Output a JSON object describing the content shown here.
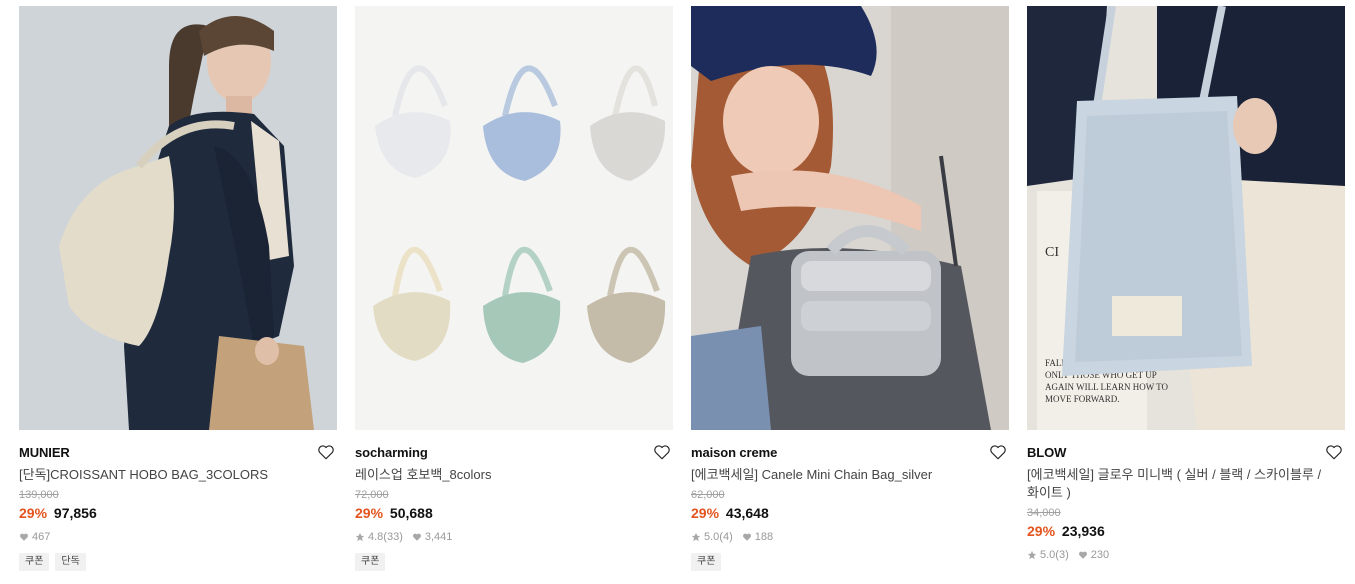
{
  "products": [
    {
      "brand": "MUNIER",
      "name": "[단독]CROISSANT HOBO BAG_3COLORS",
      "original_price": "139,000",
      "discount": "29%",
      "price": "97,856",
      "rating": "",
      "reviews": "",
      "likes": "467",
      "tags": [
        "쿠폰",
        "단독"
      ]
    },
    {
      "brand": "socharming",
      "name": "레이스업 호보백_8colors",
      "original_price": "72,000",
      "discount": "29%",
      "price": "50,688",
      "rating": "4.8",
      "reviews": "(33)",
      "likes": "3,441",
      "tags": [
        "쿠폰"
      ]
    },
    {
      "brand": "maison creme",
      "name": "[에코백세일] Canele Mini Chain Bag_silver",
      "original_price": "62,000",
      "discount": "29%",
      "price": "43,648",
      "rating": "5.0",
      "reviews": "(4)",
      "likes": "188",
      "tags": [
        "쿠폰"
      ]
    },
    {
      "brand": "BLOW",
      "name": "[에코백세일] 글로우 미니백 ( 실버 / 블랙 / 스카이블루 / 화이트 )",
      "original_price": "34,000",
      "discount": "29%",
      "price": "23,936",
      "rating": "5.0",
      "reviews": "(3)",
      "likes": "230",
      "tags": []
    }
  ],
  "icons": {
    "wishlist": "heart-outline-icon",
    "likes": "heart-filled-icon",
    "rating": "star-icon"
  },
  "colors": {
    "discount": "#e4541f",
    "muted": "#999999"
  }
}
